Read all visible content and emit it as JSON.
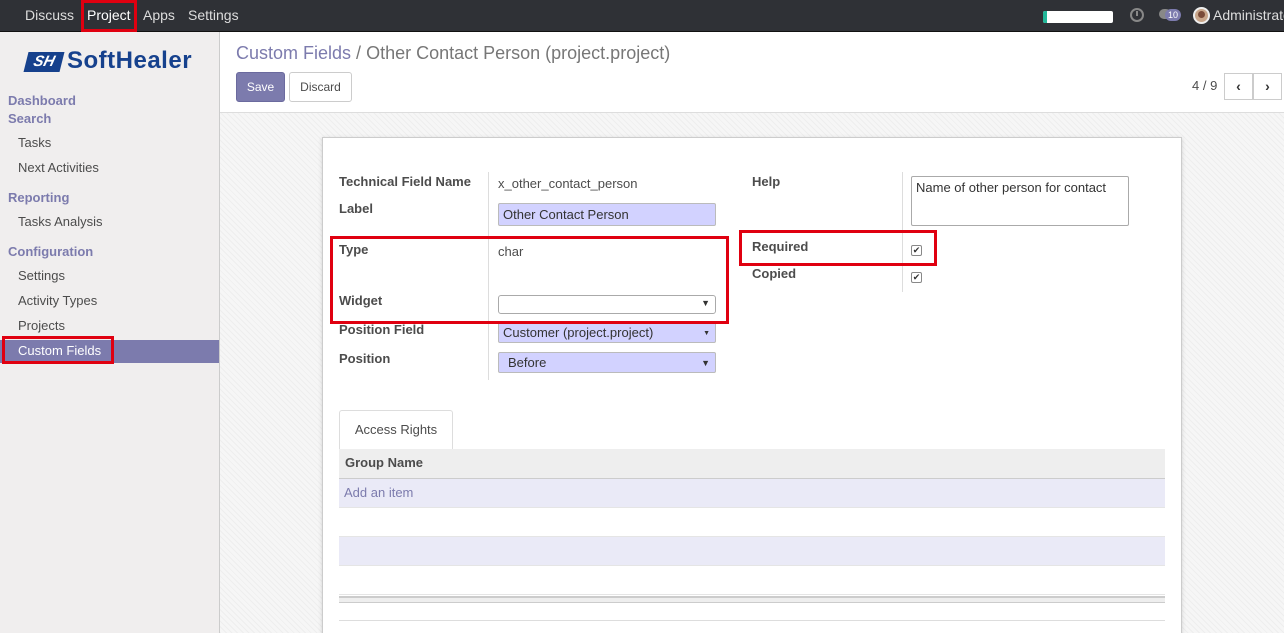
{
  "topbar": {
    "menus": [
      "Discuss",
      "Project",
      "Apps",
      "Settings"
    ],
    "active_menu": "Project",
    "messages_count": "10",
    "user": "Administrator"
  },
  "sidebar": {
    "logo": "SoftHealer",
    "logo_mark": "SH",
    "sections": {
      "dashboard": "Dashboard",
      "search": "Search",
      "tasks": "Tasks",
      "next_activities": "Next Activities",
      "reporting": "Reporting",
      "tasks_analysis": "Tasks Analysis",
      "configuration": "Configuration",
      "settings": "Settings",
      "activity_types": "Activity Types",
      "projects": "Projects",
      "custom_fields": "Custom Fields"
    }
  },
  "control_panel": {
    "breadcrumb_parent": "Custom Fields",
    "breadcrumb_sep": "/",
    "breadcrumb_current": "Other Contact Person (project.project)",
    "save_label": "Save",
    "discard_label": "Discard",
    "pager": "4 / 9",
    "prev_icon": "‹",
    "next_icon": "›"
  },
  "form": {
    "technical_field_name_label": "Technical Field Name",
    "technical_field_name": "x_other_contact_person",
    "label_label": "Label",
    "label_value": "Other Contact Person",
    "type_label": "Type",
    "type_value": "char",
    "widget_label": "Widget",
    "widget_value": "",
    "position_field_label": "Position Field",
    "position_field_value": "Customer (project.project)",
    "position_label": "Position",
    "position_value": "Before",
    "help_label": "Help",
    "help_value": "Name of other person for contact",
    "required_label": "Required",
    "required_checked": true,
    "copied_label": "Copied",
    "copied_checked": true
  },
  "notebook": {
    "tab_label": "Access Rights",
    "column_group_name": "Group Name",
    "add_item": "Add an item"
  },
  "colors": {
    "accent": "#7c7bad",
    "highlight": "#e00010",
    "topbar": "#2f3136"
  }
}
